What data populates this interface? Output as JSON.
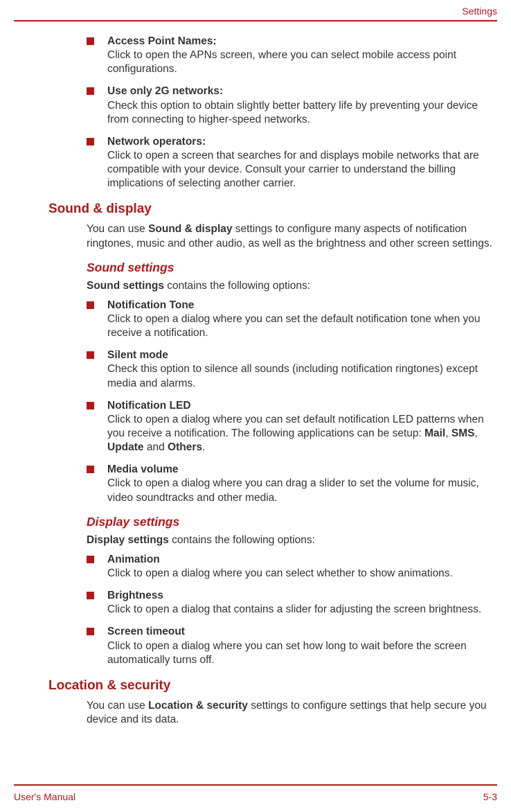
{
  "header": {
    "section_label": "Settings"
  },
  "footer": {
    "left": "User's Manual",
    "right": "5-3"
  },
  "top_list": [
    {
      "title": "Access Point Names:",
      "desc": "Click to open the APNs screen, where you can select mobile access point configurations."
    },
    {
      "title": "Use only 2G networks:",
      "desc": "Check this option to obtain slightly better battery life by preventing your device from connecting to higher-speed networks."
    },
    {
      "title": "Network operators:",
      "desc": "Click to open a screen that searches for and displays mobile networks that are compatible with your device. Consult your carrier to understand the billing implications of selecting another carrier."
    }
  ],
  "sound_display": {
    "heading": "Sound & display",
    "intro_pre": "You can use ",
    "intro_bold": "Sound & display",
    "intro_post": " settings to configure many aspects of notification ringtones, music and other audio, as well as the brightness and other screen settings.",
    "sound_settings": {
      "heading": "Sound settings",
      "lead_bold": "Sound settings",
      "lead_rest": " contains the following options:",
      "items": [
        {
          "title": "Notification Tone",
          "desc": "Click to open a dialog where you can set the default notification tone when you receive a notification."
        },
        {
          "title": "Silent mode",
          "desc": "Check this option to silence all sounds (including notification ringtones) except media and alarms."
        },
        {
          "title": "Notification LED",
          "desc_pre": "Click to open a dialog where you can set default notification LED patterns when you receive a notification. The following applications can be setup: ",
          "b1": "Mail",
          "s1": ", ",
          "b2": "SMS",
          "s2": ", ",
          "b3": "Update",
          "s3": " and ",
          "b4": "Others",
          "s4": "."
        },
        {
          "title": "Media volume",
          "desc": "Click to open a dialog where you can drag a slider to set the volume for music, video soundtracks and other media."
        }
      ]
    },
    "display_settings": {
      "heading": "Display settings",
      "lead_bold": "Display settings",
      "lead_rest": " contains the following options:",
      "items": [
        {
          "title": "Animation",
          "desc": "Click to open a dialog where you can select whether to show animations."
        },
        {
          "title": "Brightness",
          "desc": "Click to open a dialog that contains a slider for adjusting the screen brightness."
        },
        {
          "title": "Screen timeout",
          "desc": "Click to open a dialog where you can set how long to wait before the screen automatically turns off."
        }
      ]
    }
  },
  "location_security": {
    "heading": "Location & security",
    "intro_pre": "You can use ",
    "intro_bold": "Location & security",
    "intro_post": " settings to configure settings that help secure you device and its data."
  }
}
